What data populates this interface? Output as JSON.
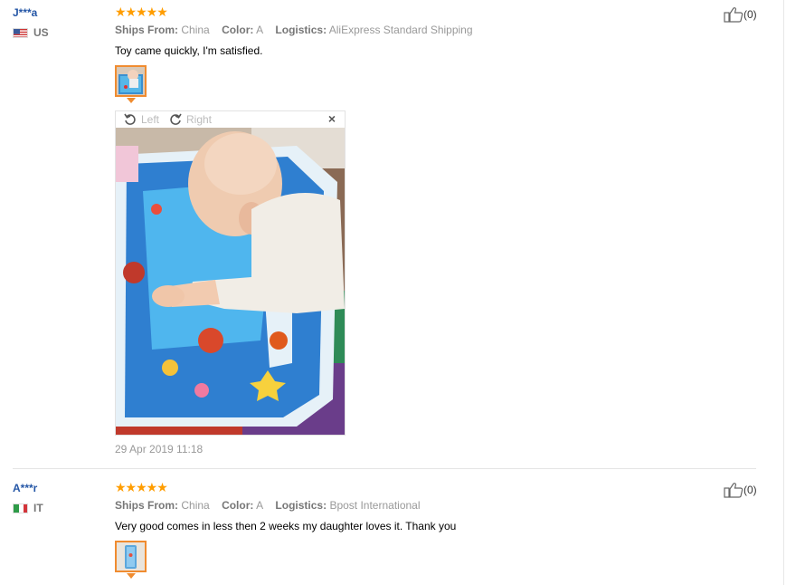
{
  "reviews": [
    {
      "user": "J***a",
      "country": "US",
      "stars": "★★★★★",
      "ships_from_label": "Ships From:",
      "ships_from": "China",
      "color_label": "Color:",
      "color": "A",
      "logistics_label": "Logistics:",
      "logistics": "AliExpress Standard Shipping",
      "text": "Toy came quickly, I'm satisfied.",
      "date": "29 Apr 2019 11:18",
      "likes": "(0)",
      "viewer": {
        "rotate_left": "Left",
        "rotate_right": "Right",
        "close": "×"
      }
    },
    {
      "user": "A***r",
      "country": "IT",
      "stars": "★★★★★",
      "ships_from_label": "Ships From:",
      "ships_from": "China",
      "color_label": "Color:",
      "color": "A",
      "logistics_label": "Logistics:",
      "logistics": "Bpost International",
      "text": "Very good comes in less then 2 weeks my daughter loves it. Thank you",
      "likes": "(0)"
    }
  ],
  "colors": {
    "username": "#2456a6",
    "star": "#ff9d00",
    "thumb_border": "#f08c30"
  },
  "icons": [
    "thumbs-up-icon",
    "rotate-left-icon",
    "rotate-right-icon",
    "close-icon"
  ]
}
